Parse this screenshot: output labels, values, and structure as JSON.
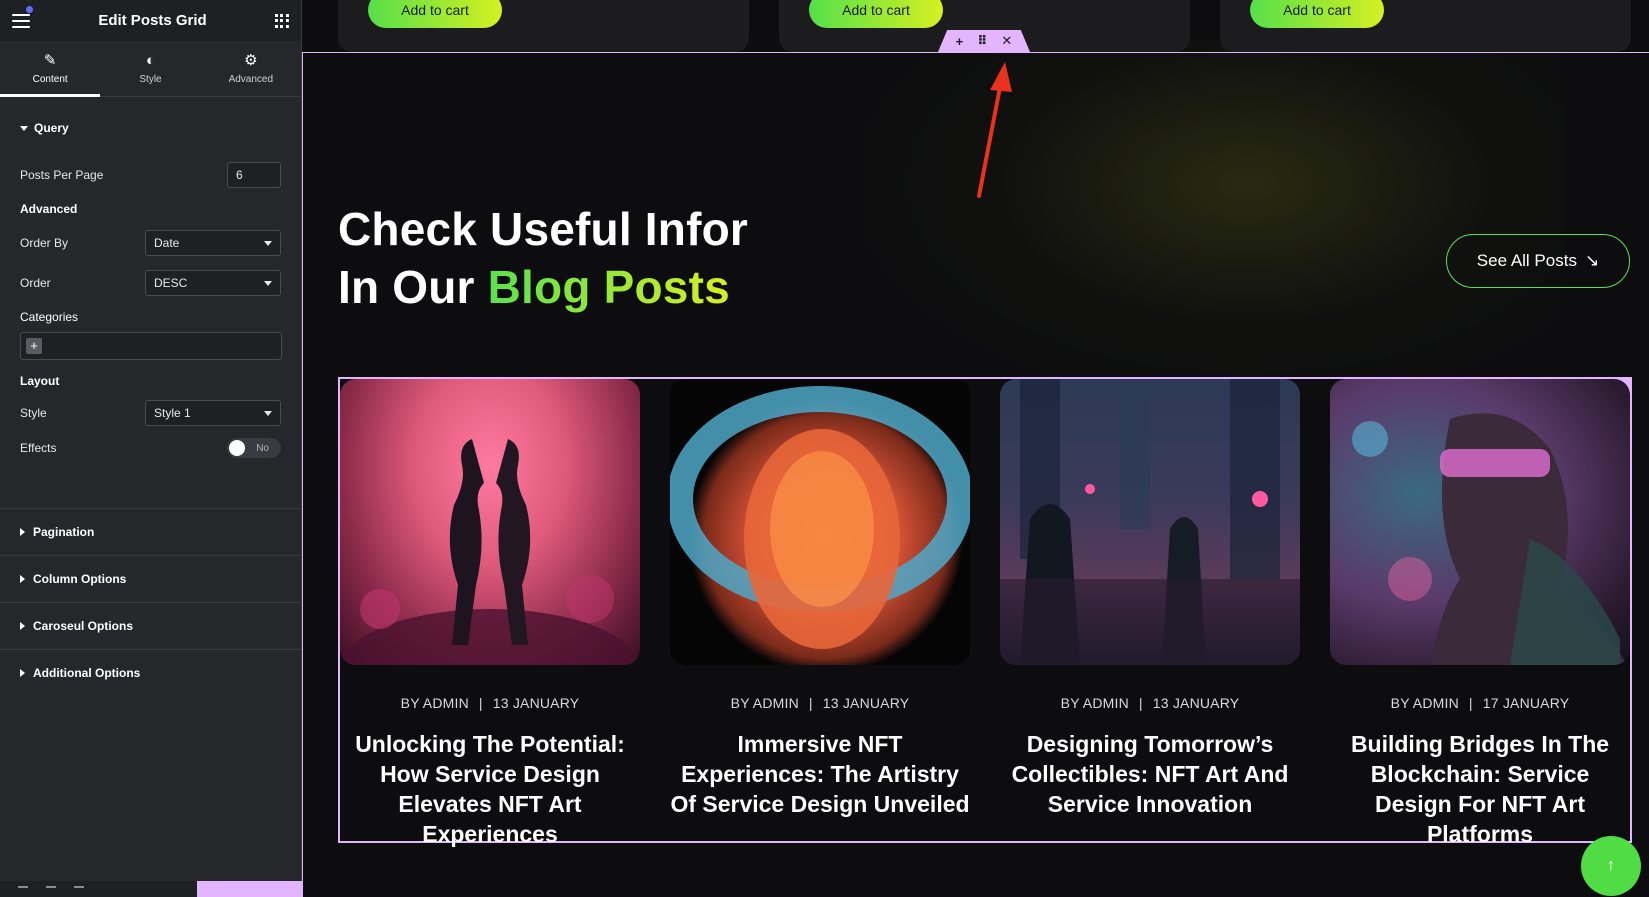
{
  "sidebar": {
    "title": "Edit Posts Grid",
    "tabs": [
      {
        "label": "Content",
        "icon": "pencil-icon"
      },
      {
        "label": "Style",
        "icon": "contrast-icon"
      },
      {
        "label": "Advanced",
        "icon": "gear-icon"
      }
    ],
    "query": {
      "title": "Query",
      "posts_per_page_label": "Posts Per Page",
      "posts_per_page_value": "6",
      "advanced_label": "Advanced",
      "order_by_label": "Order By",
      "order_by_value": "Date",
      "order_label": "Order",
      "order_value": "DESC",
      "categories_label": "Categories",
      "layout_label": "Layout",
      "style_label": "Style",
      "style_value": "Style 1",
      "effects_label": "Effects",
      "effects_toggle": "No"
    },
    "sections": [
      "Pagination",
      "Column Options",
      "Caroseul Options",
      "Additional Options"
    ]
  },
  "products": {
    "add_to_cart": "Add to cart"
  },
  "blog": {
    "heading_line1": "Check Useful Infor",
    "heading_line2_plain": "In Our ",
    "heading_line2_highlight": "Blog Posts",
    "see_all": "See All Posts",
    "posts": [
      {
        "author": "BY ADMIN",
        "date": "13 JANUARY",
        "title": "Unlocking The Potential: How Service Design Elevates NFT Art Experiences"
      },
      {
        "author": "BY ADMIN",
        "date": "13 JANUARY",
        "title": "Immersive NFT Experiences: The Artistry Of Service Design Unveiled"
      },
      {
        "author": "BY ADMIN",
        "date": "13 JANUARY",
        "title": "Designing Tomorrow’s Collectibles: NFT Art And Service Innovation"
      },
      {
        "author": "BY ADMIN",
        "date": "17 JANUARY",
        "title": "Building Bridges In The Blockchain: Service Design For NFT Art Platforms"
      }
    ]
  },
  "colors": {
    "accent_green": "#58e14c",
    "accent_lime": "#d8ef23",
    "editor_pink": "#e3b5ff",
    "arrow_red": "#e8321e"
  }
}
